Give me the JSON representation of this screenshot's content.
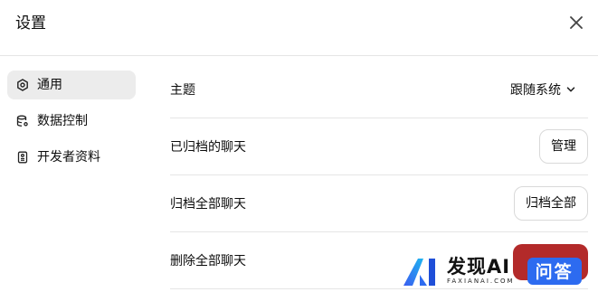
{
  "dialog": {
    "title": "设置",
    "close_icon": "close-icon"
  },
  "sidebar": {
    "items": [
      {
        "label": "通用",
        "icon": "gear-icon",
        "active": true
      },
      {
        "label": "数据控制",
        "icon": "database-icon",
        "active": false
      },
      {
        "label": "开发者资料",
        "icon": "id-card-icon",
        "active": false
      }
    ]
  },
  "settings": {
    "theme": {
      "label": "主题",
      "value": "跟随系统"
    },
    "archived": {
      "label": "已归档的聊天",
      "button": "管理"
    },
    "archive_all": {
      "label": "归档全部聊天",
      "button": "归档全部"
    },
    "delete_all": {
      "label": "删除全部聊天"
    }
  },
  "watermark": {
    "main": "发现AI",
    "sub": "FAXIANAI.COM",
    "badge": "问答"
  },
  "colors": {
    "active_nav_bg": "#ececec",
    "danger": "#b32a2a",
    "divider": "#e5e5e5",
    "badge": "#2d6bf0"
  }
}
